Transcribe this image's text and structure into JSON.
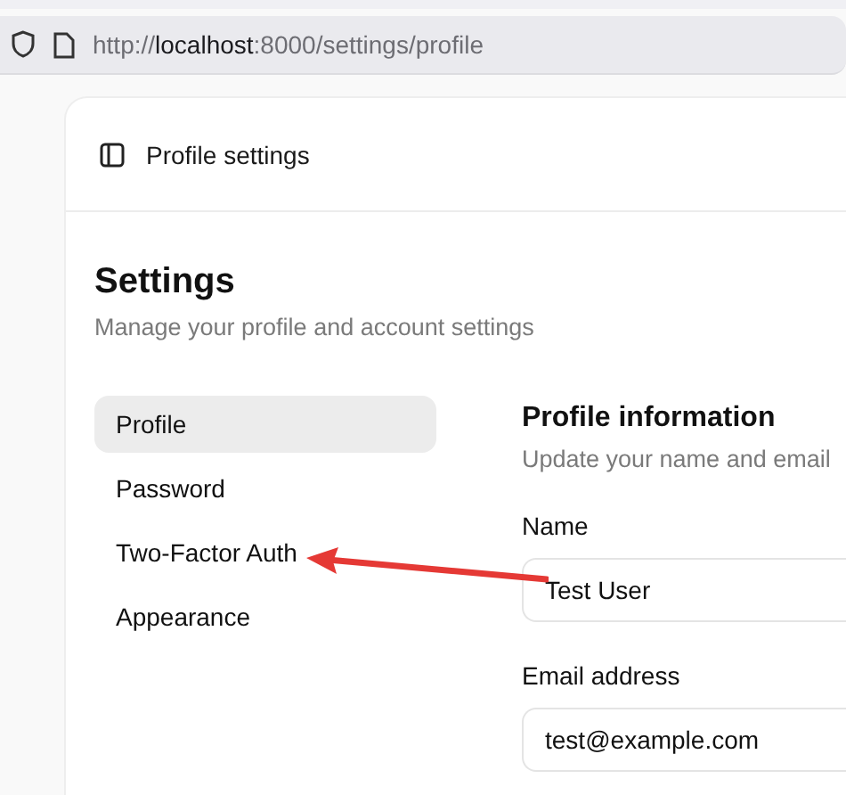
{
  "browser": {
    "url": "http://**localhost**:8000/settings/profile"
  },
  "header": {
    "title": "Profile settings"
  },
  "settings": {
    "title": "Settings",
    "subtitle": "Manage your profile and account settings"
  },
  "nav": [
    {
      "label": "Profile",
      "selected": true
    },
    {
      "label": "Password",
      "selected": false
    },
    {
      "label": "Two-Factor Auth",
      "selected": false
    },
    {
      "label": "Appearance",
      "selected": false
    }
  ],
  "section": {
    "title": "Profile information",
    "subtitle": "Update your name and email"
  },
  "fields": [
    {
      "label": "Name",
      "value": "Test User"
    },
    {
      "label": "Email address",
      "value": "test@example.com"
    }
  ]
}
